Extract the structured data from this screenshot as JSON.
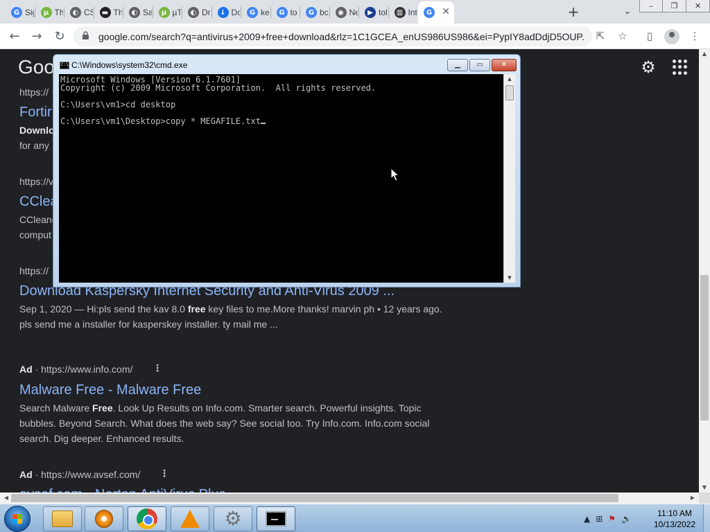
{
  "browser": {
    "tabs": [
      {
        "title": "Sig",
        "favicon": "google-g-icon"
      },
      {
        "title": "Th",
        "favicon": "utorrent-icon"
      },
      {
        "title": "CS",
        "favicon": "globe-icon"
      },
      {
        "title": "Th",
        "favicon": "car-icon"
      },
      {
        "title": "Sa",
        "favicon": "globe-icon"
      },
      {
        "title": "µT",
        "favicon": "utorrent-icon"
      },
      {
        "title": "Dr",
        "favicon": "globe-icon"
      },
      {
        "title": "Dc",
        "favicon": "download-icon"
      },
      {
        "title": "ke",
        "favicon": "google-g-icon"
      },
      {
        "title": "to",
        "favicon": "google-g-icon"
      },
      {
        "title": "bc",
        "favicon": "google-g-icon"
      },
      {
        "title": "Ne",
        "favicon": "chrome-icon"
      },
      {
        "title": "tol",
        "favicon": "play-icon"
      },
      {
        "title": "Int",
        "favicon": "archive-icon"
      },
      {
        "title": "",
        "favicon": "google-g-icon",
        "active": true
      }
    ],
    "new_tab_glyph": "+",
    "tab_close_glyph": "✕",
    "url": "google.com/search?q=antivirus+2009+free+download&rlz=1C1GCEA_enUS986US986&ei=PypIY8adDdjD5OUP...",
    "window_buttons": {
      "minimize": "–",
      "maximize": "❐",
      "close": "✕"
    }
  },
  "google": {
    "logo": "Goo",
    "results": [
      {
        "url": "https://",
        "title": "Fortir",
        "snippet_bold": "Downlo",
        "snippet_line2": "for any"
      },
      {
        "url": "https://v",
        "title": "CClea",
        "snippet_line1": "CCleane",
        "snippet_line2": "comput"
      },
      {
        "url": "https://",
        "title": "Download Kaspersky Internet Security and Anti-Virus 2009 ...",
        "date": "Sep 1, 2020",
        "snippet_a": " — Hi:pls send the kav 8.0 ",
        "snippet_bold": "free",
        "snippet_b": " key files to me.More thanks! marvin ph • 12 years ago.",
        "snippet_line2": "pls send me a installer for kasperskey installer. ty mail me ..."
      }
    ],
    "ads": [
      {
        "label": "Ad",
        "url": "https://www.info.com/",
        "title": "Malware Free - Malware Free",
        "snippet_a": "Search Malware ",
        "snippet_bold": "Free",
        "snippet_b": ". Look Up Results on Info.com. Smarter search. Powerful insights. Topic",
        "snippet_line2": "bubbles. Beyond Search. What does the web say? See social too. Try Info.com. Info.com social",
        "snippet_line3": "search. Dig deeper. Enhanced results."
      },
      {
        "label": "Ad",
        "url": "https://www.avsef.com/",
        "title": "avsef.com - Norton AntiVirus Plus"
      }
    ]
  },
  "cmd": {
    "title": "C:\\Windows\\system32\\cmd.exe",
    "lines": [
      "Microsoft Windows [Version 6.1.7601]",
      "Copyright (c) 2009 Microsoft Corporation.  All rights reserved.",
      "",
      "C:\\Users\\vm1>cd desktop",
      "",
      "C:\\Users\\vm1\\Desktop>copy * MEGAFILE.txt"
    ],
    "buttons": {
      "minimize": "▁",
      "maximize": "▭",
      "close": "✕"
    }
  },
  "taskbar": {
    "clock_time": "11:10 AM",
    "clock_date": "10/13/2022"
  }
}
